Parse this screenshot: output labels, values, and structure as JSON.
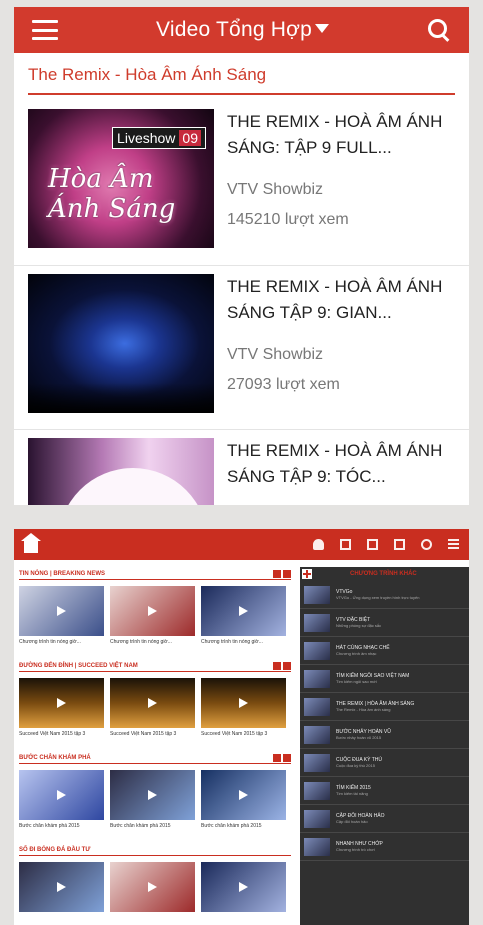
{
  "colors": {
    "brand": "#d23a2d",
    "section": "#cf3c2c"
  },
  "app": {
    "title": "Video Tổng Hợp"
  },
  "section": {
    "title": "The Remix - Hòa Âm Ánh Sáng"
  },
  "videos": [
    {
      "title": "THE REMIX - HOÀ ÂM ÁNH SÁNG: TẬP 9 FULL...",
      "channel": "VTV Showbiz",
      "views": "145210 lượt xem",
      "thumb_badge": "Liveshow",
      "thumb_badge_num": "09",
      "thumb_art": "Hòa Âm Ánh Sáng"
    },
    {
      "title": "THE REMIX - HOÀ ÂM ÁNH SÁNG TẬP 9: GIAN...",
      "channel": "VTV Showbiz",
      "views": "27093 lượt xem"
    },
    {
      "title": "THE REMIX - HOÀ ÂM ÁNH SÁNG TẬP 9: TÓC...",
      "channel": "",
      "views": ""
    }
  ],
  "web": {
    "groups": [
      {
        "title": "TIN NÓNG | BREAKING NEWS",
        "captions": [
          "Chương trình tin nóng giờ...",
          "Chương trình tin nóng giờ...",
          "Chương trình tin nóng giờ..."
        ]
      },
      {
        "title": "ĐƯỜNG ĐẾN ĐỈNH | SUCCEED VIỆT NAM",
        "captions": [
          "Succeed Việt Nam 2015 tập 3",
          "Succeed Việt Nam 2015 tập 3",
          "Succeed Việt Nam 2015 tập 3"
        ]
      },
      {
        "title": "BƯỚC CHÂN KHÁM PHÁ",
        "captions": [
          "Bước chân khám phá 2015",
          "Bước chân khám phá 2015",
          "Bước chân khám phá 2015"
        ]
      },
      {
        "title": "SỐ ĐI BÓNG ĐÁ ĐẦU TƯ",
        "captions": [
          "",
          "",
          ""
        ]
      }
    ],
    "sidebar": {
      "title": "CHƯƠNG TRÌNH KHÁC",
      "items": [
        {
          "title": "VTVGo",
          "sub": "VTVGo - Ứng dụng xem truyền hình trực tuyến"
        },
        {
          "title": "VTV ĐẶC BIỆT",
          "sub": "Những phóng sự đặc sắc"
        },
        {
          "title": "HÁT CÙNG NHẠC CHẾ",
          "sub": "Chương trình âm nhạc"
        },
        {
          "title": "TÌM KIẾM NGÔI SAO VIỆT NAM",
          "sub": "Tìm kiếm ngôi sao mới"
        },
        {
          "title": "THE REMIX | HÒA ÂM ÁNH SÁNG",
          "sub": "The Remix - Hòa âm ánh sáng"
        },
        {
          "title": "BƯỚC NHẢY HOÀN VŨ",
          "sub": "Bước nhảy hoàn vũ 2015"
        },
        {
          "title": "CUỘC ĐUA KỲ THÚ",
          "sub": "Cuộc đua kỳ thú 2015"
        },
        {
          "title": "TÌM KIẾM 2015",
          "sub": "Tìm kiếm tài năng"
        },
        {
          "title": "CẶP ĐÔI HOÀN HẢO",
          "sub": "Cặp đôi hoàn hảo"
        },
        {
          "title": "NHANH NHƯ CHỚP",
          "sub": "Chương trình trò chơi"
        }
      ]
    }
  }
}
